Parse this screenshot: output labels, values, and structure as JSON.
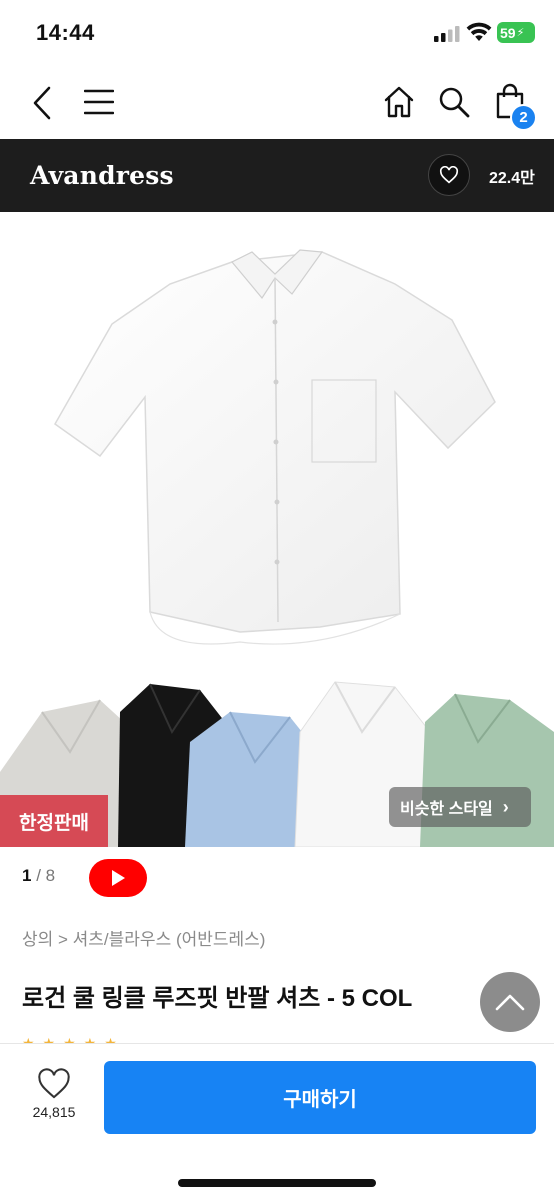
{
  "status_bar": {
    "time": "14:44",
    "battery": "59"
  },
  "nav": {
    "cart_count": "2"
  },
  "brand": {
    "name": "Avandress",
    "likes": "22.4만"
  },
  "hero": {
    "badge_limited": "한정판매",
    "similar_label": "비슷한 스타일",
    "current_index": "1",
    "total": "8"
  },
  "product": {
    "breadcrumb": "상의 > 셔츠/블라우스 (어반드레스)",
    "title": "로건 쿨 링클 루즈핏 반팔 셔츠 - 5 COL"
  },
  "bottom_bar": {
    "like_count": "24,815",
    "buy_label": "구매하기"
  },
  "colors": {
    "accent": "#1783f4",
    "limited": "#d64a55",
    "brand_bar": "#1d1d1d",
    "youtube": "#ff0000",
    "battery": "#39c353"
  },
  "icons": [
    "back-icon",
    "menu-icon",
    "home-icon",
    "search-icon",
    "cart-icon",
    "heart-icon",
    "youtube-play-icon",
    "chevron-up-icon",
    "chevron-right-icon"
  ]
}
